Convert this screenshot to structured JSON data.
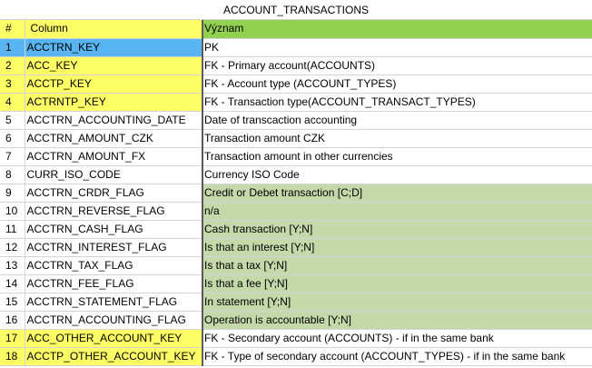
{
  "title": "ACCOUNT_TRANSACTIONS",
  "headers": {
    "num": "#",
    "column": "Column",
    "meaning": "Význam"
  },
  "colors": {
    "header_fill": "#ffff66",
    "meaning_header_fill": "#92d050",
    "key_fill": "#ffff66",
    "selected_fill": "#59b4f2",
    "flag_fill": "#c4d8a9",
    "plain_fill": "#ffffff"
  },
  "rows": [
    {
      "num": "1",
      "column": "ACCTRN_KEY",
      "meaning": "PK",
      "num_fill": "#59b4f2",
      "col_fill": "#59b4f2",
      "mean_fill": "#ffffff"
    },
    {
      "num": "2",
      "column": "ACC_KEY",
      "meaning": "FK - Primary account(ACCOUNTS)",
      "num_fill": "#ffff66",
      "col_fill": "#ffff66",
      "mean_fill": "#ffffff"
    },
    {
      "num": "3",
      "column": "ACCTP_KEY",
      "meaning": "FK - Account type (ACCOUNT_TYPES)",
      "num_fill": "#ffff66",
      "col_fill": "#ffff66",
      "mean_fill": "#ffffff"
    },
    {
      "num": "4",
      "column": "ACTRNTP_KEY",
      "meaning": "FK - Transaction type(ACCOUNT_TRANSACT_TYPES)",
      "num_fill": "#ffff66",
      "col_fill": "#ffff66",
      "mean_fill": "#ffffff"
    },
    {
      "num": "5",
      "column": "ACCTRN_ACCOUNTING_DATE",
      "meaning": "Date of transcaction accounting",
      "num_fill": "#ffffff",
      "col_fill": "#ffffff",
      "mean_fill": "#ffffff"
    },
    {
      "num": "6",
      "column": "ACCTRN_AMOUNT_CZK",
      "meaning": "Transaction amount CZK",
      "num_fill": "#ffffff",
      "col_fill": "#ffffff",
      "mean_fill": "#ffffff"
    },
    {
      "num": "7",
      "column": "ACCTRN_AMOUNT_FX",
      "meaning": "Transaction amount in other currencies",
      "num_fill": "#ffffff",
      "col_fill": "#ffffff",
      "mean_fill": "#ffffff"
    },
    {
      "num": "8",
      "column": "CURR_ISO_CODE",
      "meaning": "Currency ISO Code",
      "num_fill": "#ffffff",
      "col_fill": "#ffffff",
      "mean_fill": "#ffffff"
    },
    {
      "num": "9",
      "column": "ACCTRN_CRDR_FLAG",
      "meaning": "Credit or Debet transaction [C;D]",
      "num_fill": "#ffffff",
      "col_fill": "#ffffff",
      "mean_fill": "#c4d8a9"
    },
    {
      "num": "10",
      "column": "ACCTRN_REVERSE_FLAG",
      "meaning": "n/a",
      "num_fill": "#ffffff",
      "col_fill": "#ffffff",
      "mean_fill": "#c4d8a9"
    },
    {
      "num": "11",
      "column": "ACCTRN_CASH_FLAG",
      "meaning": "Cash transaction [Y;N]",
      "num_fill": "#ffffff",
      "col_fill": "#ffffff",
      "mean_fill": "#c4d8a9"
    },
    {
      "num": "12",
      "column": "ACCTRN_INTEREST_FLAG",
      "meaning": "Is that an interest  [Y;N]",
      "num_fill": "#ffffff",
      "col_fill": "#ffffff",
      "mean_fill": "#c4d8a9"
    },
    {
      "num": "13",
      "column": "ACCTRN_TAX_FLAG",
      "meaning": "Is that a tax  [Y;N]",
      "num_fill": "#ffffff",
      "col_fill": "#ffffff",
      "mean_fill": "#c4d8a9"
    },
    {
      "num": "14",
      "column": "ACCTRN_FEE_FLAG",
      "meaning": "Is that a fee  [Y;N]",
      "num_fill": "#ffffff",
      "col_fill": "#ffffff",
      "mean_fill": "#c4d8a9"
    },
    {
      "num": "15",
      "column": "ACCTRN_STATEMENT_FLAG",
      "meaning": "In statement [Y;N]",
      "num_fill": "#ffffff",
      "col_fill": "#ffffff",
      "mean_fill": "#c4d8a9"
    },
    {
      "num": "16",
      "column": "ACCTRN_ACCOUNTING_FLAG",
      "meaning": "Operation is accountable  [Y;N]",
      "num_fill": "#ffffff",
      "col_fill": "#ffffff",
      "mean_fill": "#c4d8a9"
    },
    {
      "num": "17",
      "column": "ACC_OTHER_ACCOUNT_KEY",
      "meaning": "FK - Secondary account (ACCOUNTS) - if in the same bank",
      "num_fill": "#ffff66",
      "col_fill": "#ffff66",
      "mean_fill": "#ffffff"
    },
    {
      "num": "18",
      "column": "ACCTP_OTHER_ACCOUNT_KEY",
      "meaning": "FK - Type of secondary account (ACCOUNT_TYPES) - if in the same bank",
      "num_fill": "#ffff66",
      "col_fill": "#ffff66",
      "mean_fill": "#ffffff"
    }
  ]
}
